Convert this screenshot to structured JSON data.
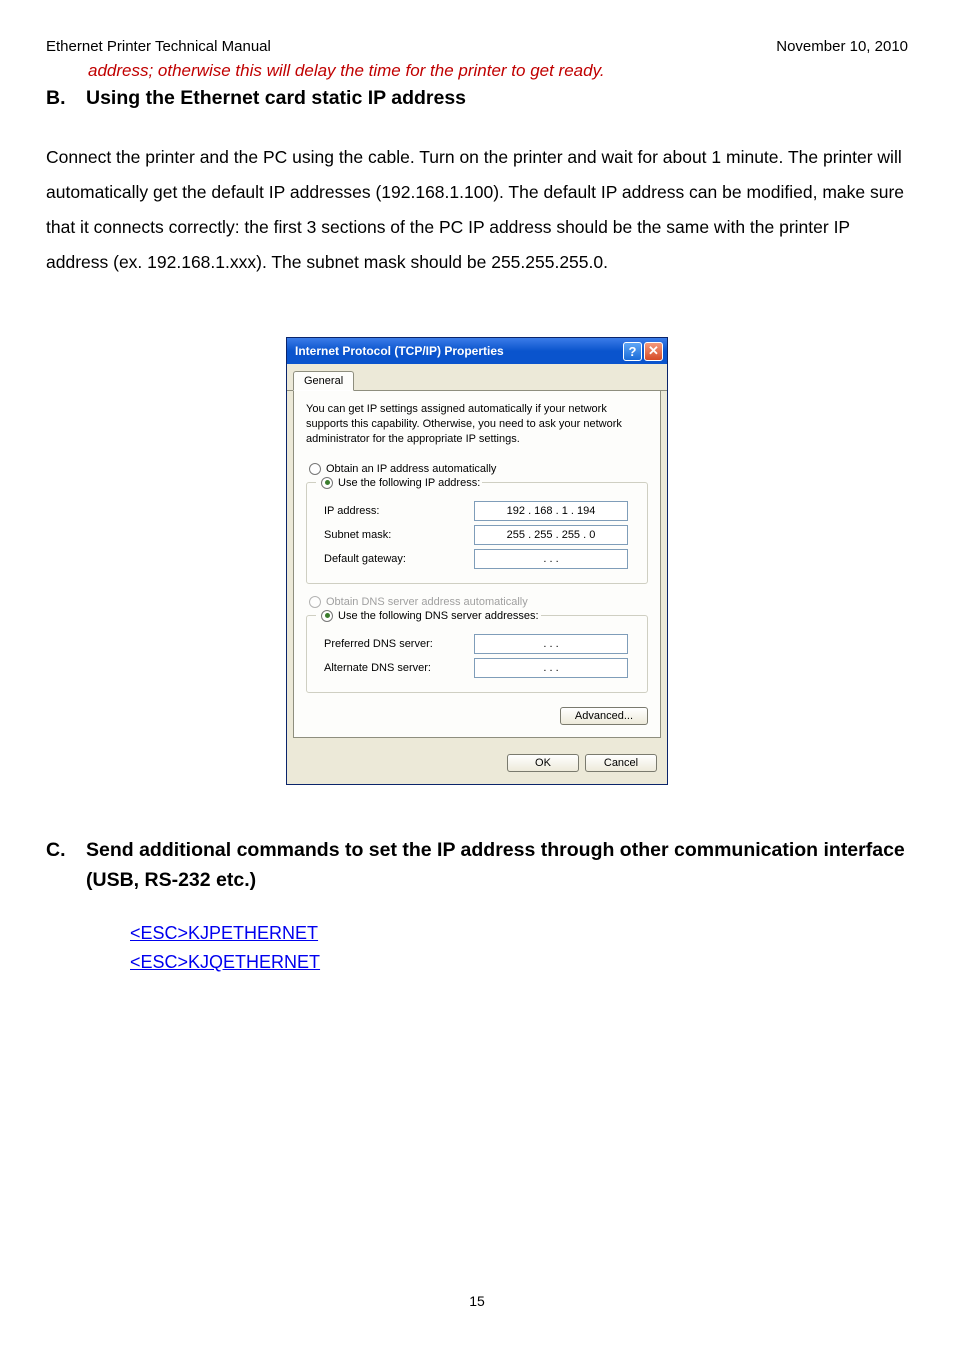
{
  "header": {
    "left": "Ethernet Printer Technical Manual",
    "right": "November 10, 2010"
  },
  "note": "address; otherwise this will delay the time for the printer to get ready.",
  "section_b": {
    "letter": "B.",
    "title": "Using the Ethernet card static IP address",
    "body": "Connect the printer and the PC using the cable. Turn on the printer and wait for about 1 minute. The printer will automatically get the default IP addresses (192.168.1.100). The default IP address can be modified, make sure that it connects correctly: the first 3 sections of the PC IP address should be the same with the printer IP address (ex. 192.168.1.xxx). The subnet mask should be 255.255.255.0."
  },
  "dialog": {
    "title": "Internet Protocol (TCP/IP) Properties",
    "help_char": "?",
    "close_char": "✕",
    "tab": "General",
    "description": "You can get IP settings assigned automatically if your network supports this capability. Otherwise, you need to ask your network administrator for the appropriate IP settings.",
    "radio_auto_ip": "Obtain an IP address automatically",
    "radio_use_ip": "Use the following IP address:",
    "ip_label": "IP address:",
    "ip_value": "192 . 168 .   1   . 194",
    "subnet_label": "Subnet mask:",
    "subnet_value": "255 . 255 . 255 .   0",
    "gateway_label": "Default gateway:",
    "gateway_value": ".           .           .",
    "radio_auto_dns": "Obtain DNS server address automatically",
    "radio_use_dns": "Use the following DNS server addresses:",
    "pref_dns_label": "Preferred DNS server:",
    "pref_dns_value": ".           .           .",
    "alt_dns_label": "Alternate DNS server:",
    "alt_dns_value": ".           .           .",
    "advanced_btn": "Advanced...",
    "ok_btn": "OK",
    "cancel_btn": "Cancel"
  },
  "section_c": {
    "letter": "C.",
    "title": "Send additional commands to set the IP address through other communication interface (USB, RS-232 etc.)",
    "link1": "<ESC>KJPETHERNET",
    "link2": "<ESC>KJQETHERNET"
  },
  "page_number": "15"
}
